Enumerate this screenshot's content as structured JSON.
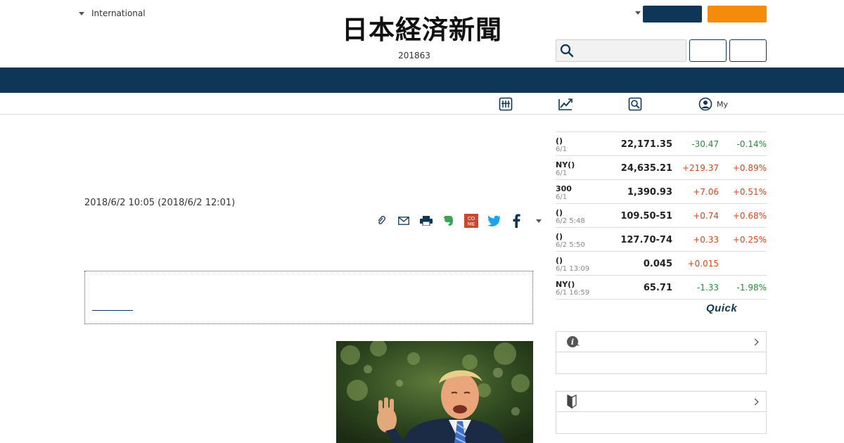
{
  "header": {
    "edition_label": "International",
    "logo_text": "日本経済新聞",
    "logo_sub": "201863",
    "search_placeholder": "",
    "search_value": ""
  },
  "subnav": {
    "items": [
      {
        "icon": "stock-board-icon",
        "label": ""
      },
      {
        "icon": "chart-trend-icon",
        "label": ""
      },
      {
        "icon": "search-magnifier-icon",
        "label": ""
      },
      {
        "icon": "user-profile-icon",
        "label": "My"
      }
    ]
  },
  "article": {
    "datetime": "2018/6/2 10:05 (2018/6/2 12:01)",
    "share_icons": [
      "clip-icon",
      "mail-icon",
      "print-icon",
      "evernote-icon",
      "come-icon",
      "twitter-icon",
      "facebook-icon",
      "more-caret-icon"
    ],
    "come_text": "CO\nME"
  },
  "market": {
    "rows": [
      {
        "name": "()",
        "date": "6/1",
        "value": "22,171.35",
        "change": "-30.47",
        "pct": "-0.14%",
        "dir": "down"
      },
      {
        "name": "NY()",
        "date": "6/1",
        "value": "24,635.21",
        "change": "+219.37",
        "pct": "+0.89%",
        "dir": "up"
      },
      {
        "name": "300",
        "date": "6/1",
        "value": "1,390.93",
        "change": "+7.06",
        "pct": "+0.51%",
        "dir": "up"
      },
      {
        "name": "()",
        "date": "6/2 5:48",
        "value": "109.50-51",
        "change": "+0.74",
        "pct": "+0.68%",
        "dir": "up"
      },
      {
        "name": "()",
        "date": "6/2 5:50",
        "value": "127.70-74",
        "change": "+0.33",
        "pct": "+0.25%",
        "dir": "up"
      },
      {
        "name": "()",
        "date": "6/1 13:09",
        "value": "0.045",
        "change": "+0.015",
        "pct": "",
        "dir": "up"
      },
      {
        "name": "NY()",
        "date": "6/1 16:59",
        "value": "65.71",
        "change": "-1.33",
        "pct": "-1.98%",
        "dir": "down"
      }
    ],
    "provider": "Quick"
  },
  "colors": {
    "navy": "#0f3656",
    "orange": "#f58b0a",
    "up": "#d4451a",
    "down": "#2a8c3a"
  }
}
